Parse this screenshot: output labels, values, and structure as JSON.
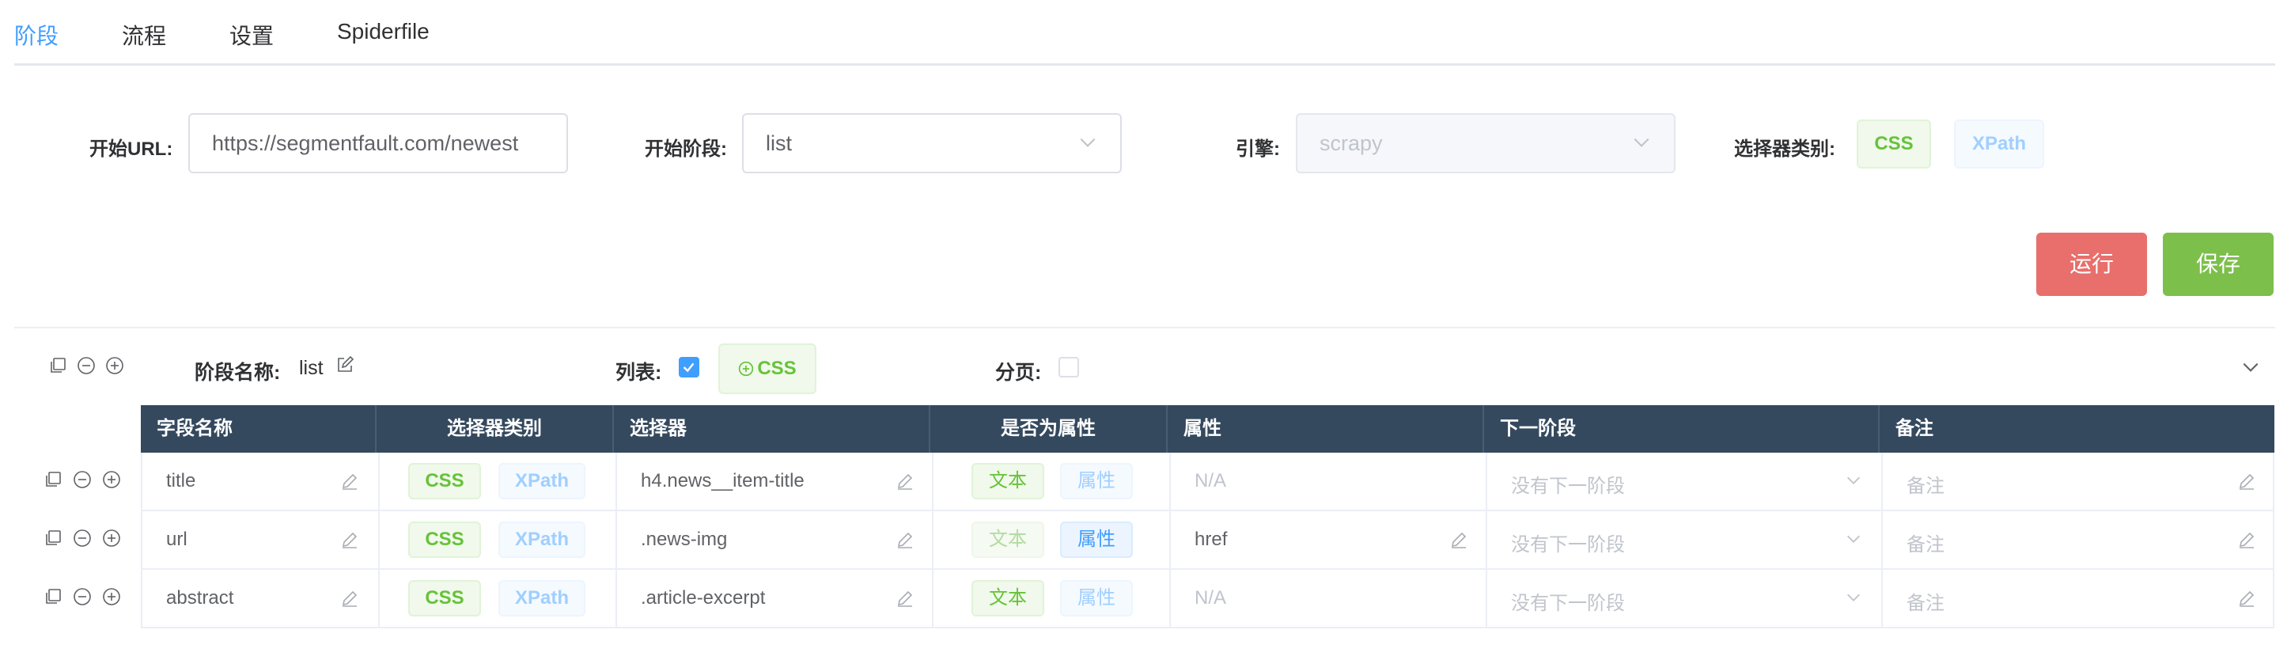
{
  "tabs": [
    {
      "label": "阶段",
      "active": true
    },
    {
      "label": "流程",
      "active": false
    },
    {
      "label": "设置",
      "active": false
    },
    {
      "label": "Spiderfile",
      "active": false
    }
  ],
  "form": {
    "start_url_label": "开始URL:",
    "start_url_value": "https://segmentfault.com/newest",
    "start_stage_label": "开始阶段:",
    "start_stage_value": "list",
    "engine_label": "引擎:",
    "engine_value": "scrapy",
    "selector_type_label": "选择器类别:",
    "selector_css": "CSS",
    "selector_xpath": "XPath"
  },
  "actions": {
    "run_label": "运行",
    "save_label": "保存"
  },
  "stage": {
    "name_label": "阶段名称:",
    "name_value": "list",
    "list_label": "列表:",
    "list_checked": true,
    "list_css_label": "CSS",
    "pagination_label": "分页:",
    "pagination_checked": false
  },
  "table": {
    "columns": [
      "字段名称",
      "选择器类别",
      "选择器",
      "是否为属性",
      "属性",
      "下一阶段",
      "备注"
    ],
    "css_label": "CSS",
    "xpath_label": "XPath",
    "text_label": "文本",
    "attr_label": "属性",
    "rows": [
      {
        "field": "title",
        "selector_type": "CSS",
        "selector": "h4.news__item-title",
        "is_attr": false,
        "attr_value": "N/A",
        "next_stage": "没有下一阶段",
        "remark": "备注"
      },
      {
        "field": "url",
        "selector_type": "CSS",
        "selector": ".news-img",
        "is_attr": true,
        "attr_value": "href",
        "next_stage": "没有下一阶段",
        "remark": "备注"
      },
      {
        "field": "abstract",
        "selector_type": "CSS",
        "selector": ".article-excerpt",
        "is_attr": false,
        "attr_value": "N/A",
        "next_stage": "没有下一阶段",
        "remark": "备注"
      }
    ]
  },
  "colors": {
    "accent": "#409eff",
    "run": "#e86f6b",
    "save": "#7cbf4a",
    "table_header": "#34495e",
    "css_green": "#67c23a"
  }
}
